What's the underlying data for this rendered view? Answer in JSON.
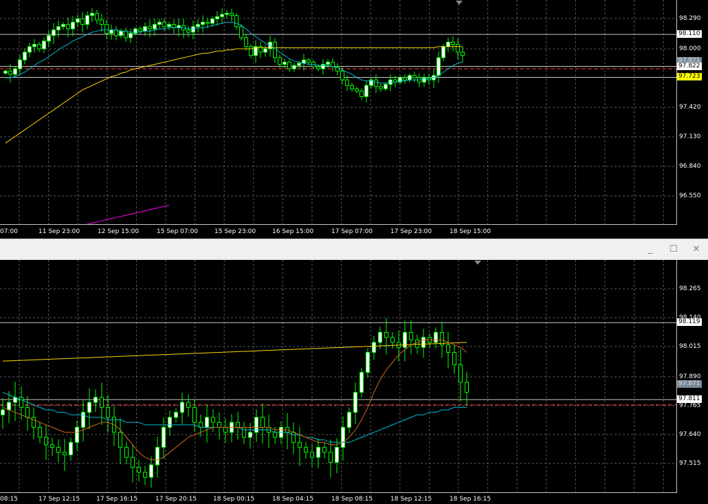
{
  "colors": {
    "background": "#000000",
    "grid": "#5a5a5a",
    "bull": "#00ff00",
    "bull_body": "#ffffff",
    "bear": "#00ff00",
    "bear_body": "#000000",
    "ma_fast": "#00bcd4",
    "ma_slow": "#ffd700",
    "ma_long": "#ff00ff",
    "ma_orange": "#d2691e",
    "price_line": "#c8c8c8",
    "bid_line": "#ff3b3b",
    "axis_text": "#ffffff",
    "window_bar": "#f0f0f0"
  },
  "window": {
    "minimize_icon": "minimize-icon",
    "maximize_icon": "maximize-icon",
    "close_icon": "close-icon",
    "minimize": "_",
    "maximize": "☐",
    "close": "✕"
  },
  "chart_data": [
    {
      "type": "candlestick",
      "timeframe_labels": [
        "07:00",
        "11 Sep 23:00",
        "12 Sep 15:00",
        "15 Sep 07:00",
        "15 Sep 23:00",
        "16 Sep 15:00",
        "17 Sep 07:00",
        "17 Sep 23:00",
        "18 Sep 15:00"
      ],
      "y_ticks": [
        "98.290",
        "98.000",
        "97.420",
        "97.130",
        "96.840",
        "96.550"
      ],
      "ylim": [
        96.4,
        98.42
      ],
      "price_boxes": [
        {
          "label": "98.110",
          "value": 98.11,
          "style": "line"
        },
        {
          "label": "97.871",
          "value": 97.871,
          "style": "ghost"
        },
        {
          "label": "97.822",
          "value": 97.822,
          "style": "line"
        },
        {
          "label": "97.723",
          "value": 97.723,
          "style": "yellow"
        }
      ],
      "bid_level": 97.8,
      "closes": [
        97.78,
        97.75,
        97.8,
        97.88,
        97.95,
        98.0,
        98.02,
        97.98,
        98.05,
        98.1,
        98.15,
        98.18,
        98.2,
        98.16,
        98.22,
        98.25,
        98.2,
        98.28,
        98.3,
        98.24,
        98.2,
        98.12,
        98.15,
        98.1,
        98.14,
        98.08,
        98.12,
        98.16,
        98.14,
        98.18,
        98.16,
        98.2,
        98.22,
        98.18,
        98.2,
        98.17,
        98.19,
        98.15,
        98.13,
        98.18,
        98.2,
        98.22,
        98.21,
        98.25,
        98.27,
        98.29,
        98.3,
        98.28,
        98.18,
        98.08,
        98.0,
        97.92,
        98.0,
        97.95,
        97.98,
        98.04,
        97.9,
        97.84,
        97.86,
        97.8,
        97.83,
        97.85,
        97.88,
        97.86,
        97.82,
        97.8,
        97.84,
        97.86,
        97.82,
        97.78,
        97.7,
        97.65,
        97.62,
        97.6,
        97.55,
        97.65,
        97.7,
        97.64,
        97.62,
        97.66,
        97.7,
        97.68,
        97.72,
        97.7,
        97.74,
        97.72,
        97.68,
        97.72,
        97.7,
        97.74,
        97.9,
        98.0,
        98.04,
        98.02,
        97.95,
        97.92
      ],
      "ma_fast": [
        97.72,
        97.72,
        97.73,
        97.75,
        97.77,
        97.8,
        97.83,
        97.86,
        97.88,
        97.91,
        97.94,
        97.97,
        98.0,
        98.02,
        98.05,
        98.07,
        98.09,
        98.11,
        98.13,
        98.14,
        98.15,
        98.15,
        98.15,
        98.15,
        98.14,
        98.14,
        98.13,
        98.13,
        98.13,
        98.14,
        98.14,
        98.15,
        98.16,
        98.16,
        98.17,
        98.17,
        98.17,
        98.17,
        98.16,
        98.16,
        98.17,
        98.17,
        98.18,
        98.19,
        98.2,
        98.21,
        98.22,
        98.22,
        98.21,
        98.19,
        98.16,
        98.12,
        98.09,
        98.06,
        98.03,
        98.01,
        97.98,
        97.95,
        97.92,
        97.89,
        97.87,
        97.86,
        97.85,
        97.84,
        97.84,
        97.83,
        97.83,
        97.83,
        97.82,
        97.81,
        97.79,
        97.77,
        97.75,
        97.72,
        97.7,
        97.69,
        97.69,
        97.68,
        97.67,
        97.67,
        97.68,
        97.68,
        97.69,
        97.69,
        97.7,
        97.7,
        97.7,
        97.71,
        97.71,
        97.72,
        97.74,
        97.77,
        97.8,
        97.83,
        97.85,
        97.86
      ],
      "ma_slow": [
        97.13,
        97.16,
        97.19,
        97.22,
        97.25,
        97.28,
        97.31,
        97.34,
        97.37,
        97.4,
        97.43,
        97.46,
        97.49,
        97.52,
        97.55,
        97.58,
        97.61,
        97.63,
        97.65,
        97.67,
        97.69,
        97.71,
        97.73,
        97.74,
        97.76,
        97.77,
        97.79,
        97.8,
        97.81,
        97.82,
        97.83,
        97.84,
        97.85,
        97.86,
        97.87,
        97.88,
        97.89,
        97.9,
        97.91,
        97.92,
        97.93,
        97.94,
        97.94,
        97.95,
        97.96,
        97.96,
        97.97,
        97.97,
        97.98,
        97.98,
        97.98,
        97.98,
        97.99,
        97.99,
        97.99,
        97.99,
        97.99,
        97.99,
        97.99,
        97.99,
        97.99,
        97.99,
        97.99,
        97.99,
        97.99,
        97.99,
        97.99,
        97.99,
        97.99,
        97.99,
        97.99,
        97.99,
        97.99,
        97.99,
        97.99,
        97.99,
        97.99,
        97.99,
        97.99,
        97.99,
        97.99,
        97.99,
        97.99,
        97.99,
        97.99,
        97.99,
        97.99,
        97.99,
        97.99,
        97.99,
        98.0,
        98.0,
        98.0,
        98.0,
        98.0,
        98.0
      ],
      "ma_long": [
        96.36,
        96.37,
        96.38,
        96.39,
        96.4,
        96.41,
        96.42,
        96.43,
        96.44,
        96.45,
        96.46,
        96.47,
        96.48,
        96.49,
        96.5,
        96.51,
        96.52,
        96.53,
        96.54,
        96.55,
        96.56,
        96.57
      ]
    },
    {
      "type": "candlestick",
      "timeframe_labels": [
        "08:15",
        "17 Sep 12:15",
        "17 Sep 16:15",
        "17 Sep 20:15",
        "18 Sep 00:15",
        "18 Sep 04:15",
        "18 Sep 08:15",
        "18 Sep 12:15",
        "18 Sep 16:15"
      ],
      "y_ticks": [
        "98.265",
        "98.140",
        "98.015",
        "97.890",
        "97.765",
        "97.640",
        "97.515"
      ],
      "ylim": [
        97.44,
        98.37
      ],
      "price_boxes": [
        {
          "label": "98.119",
          "value": 98.119,
          "style": "line"
        },
        {
          "label": "97.871",
          "value": 97.871,
          "style": "ghost"
        },
        {
          "label": "97.811",
          "value": 97.811,
          "style": "line"
        }
      ],
      "bid_level": 97.79,
      "closes": [
        97.77,
        97.8,
        97.82,
        97.78,
        97.74,
        97.7,
        97.66,
        97.63,
        97.62,
        97.6,
        97.59,
        97.64,
        97.7,
        97.76,
        97.8,
        97.82,
        97.78,
        97.74,
        97.68,
        97.62,
        97.58,
        97.54,
        97.52,
        97.5,
        97.55,
        97.62,
        97.7,
        97.74,
        97.76,
        97.8,
        97.78,
        97.72,
        97.7,
        97.74,
        97.72,
        97.7,
        97.68,
        97.72,
        97.7,
        97.66,
        97.68,
        97.74,
        97.7,
        97.68,
        97.66,
        97.7,
        97.68,
        97.64,
        97.62,
        97.6,
        97.58,
        97.62,
        97.6,
        97.56,
        97.62,
        97.7,
        97.76,
        97.84,
        97.92,
        98.0,
        98.04,
        98.08,
        98.06,
        98.04,
        98.02,
        98.08,
        98.05,
        98.02,
        98.06,
        98.04,
        98.08,
        98.03,
        98.0,
        97.95,
        97.88,
        97.84
      ],
      "ma_fast": [
        97.84,
        97.83,
        97.82,
        97.81,
        97.8,
        97.79,
        97.78,
        97.77,
        97.77,
        97.76,
        97.76,
        97.75,
        97.75,
        97.75,
        97.74,
        97.74,
        97.74,
        97.73,
        97.73,
        97.73,
        97.72,
        97.72,
        97.72,
        97.71,
        97.71,
        97.71,
        97.71,
        97.71,
        97.71,
        97.71,
        97.71,
        97.71,
        97.7,
        97.7,
        97.7,
        97.7,
        97.7,
        97.7,
        97.7,
        97.69,
        97.69,
        97.69,
        97.69,
        97.69,
        97.68,
        97.68,
        97.68,
        97.67,
        97.67,
        97.66,
        97.66,
        97.65,
        97.65,
        97.64,
        97.64,
        97.64,
        97.64,
        97.65,
        97.66,
        97.67,
        97.68,
        97.69,
        97.7,
        97.71,
        97.72,
        97.73,
        97.74,
        97.75,
        97.75,
        97.76,
        97.76,
        97.77,
        97.77,
        97.78,
        97.78,
        97.78
      ],
      "ma_slow": [
        97.965,
        97.966,
        97.967,
        97.968,
        97.969,
        97.97,
        97.971,
        97.972,
        97.973,
        97.974,
        97.975,
        97.976,
        97.977,
        97.978,
        97.979,
        97.98,
        97.981,
        97.982,
        97.983,
        97.984,
        97.985,
        97.986,
        97.987,
        97.988,
        97.989,
        97.99,
        97.991,
        97.992,
        97.993,
        97.994,
        97.995,
        97.996,
        97.997,
        97.998,
        97.999,
        98.0,
        98.001,
        98.002,
        98.003,
        98.004,
        98.005,
        98.006,
        98.007,
        98.008,
        98.009,
        98.01,
        98.011,
        98.012,
        98.013,
        98.014,
        98.015,
        98.016,
        98.017,
        98.018,
        98.019,
        98.02,
        98.021,
        98.022,
        98.023,
        98.024,
        98.025,
        98.026,
        98.027,
        98.028,
        98.029,
        98.03,
        98.031,
        98.032,
        98.033,
        98.034,
        98.035,
        98.036,
        98.037,
        98.038,
        98.039,
        98.04
      ],
      "ma_orange": [
        97.78,
        97.77,
        97.76,
        97.75,
        97.74,
        97.73,
        97.72,
        97.71,
        97.7,
        97.69,
        97.68,
        97.68,
        97.68,
        97.69,
        97.7,
        97.71,
        97.72,
        97.72,
        97.71,
        97.69,
        97.66,
        97.63,
        97.6,
        97.58,
        97.57,
        97.57,
        97.58,
        97.6,
        97.62,
        97.64,
        97.66,
        97.67,
        97.68,
        97.69,
        97.7,
        97.7,
        97.7,
        97.7,
        97.7,
        97.7,
        97.7,
        97.7,
        97.7,
        97.7,
        97.69,
        97.69,
        97.69,
        97.68,
        97.67,
        97.66,
        97.65,
        97.64,
        97.64,
        97.63,
        97.63,
        97.64,
        97.66,
        97.69,
        97.73,
        97.78,
        97.84,
        97.89,
        97.93,
        97.96,
        97.99,
        98.01,
        98.03,
        98.04,
        98.05,
        98.05,
        98.05,
        98.05,
        98.04,
        98.03,
        98.02,
        98.0
      ]
    }
  ]
}
